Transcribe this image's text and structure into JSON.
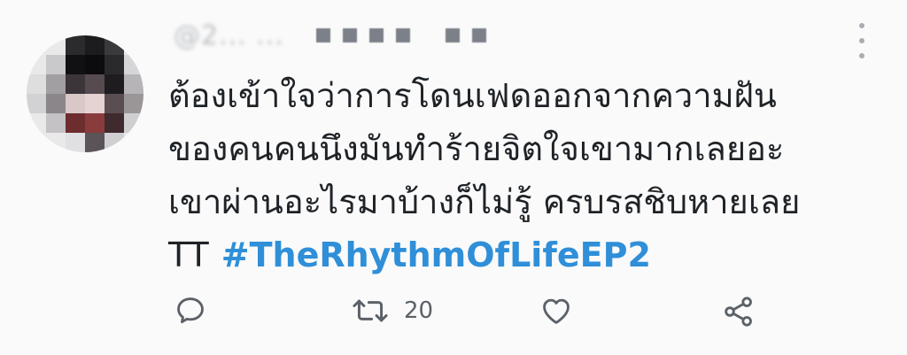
{
  "tweet": {
    "handle": "@2... ...",
    "text_lines": [
      "ต้องเข้าใจว่าการโดนเฟดออกจากความฝัน",
      "ของคนคนนึงมันทำร้ายจิตใจเขามากเลยอะ",
      "เขาผ่านอะไรมาบ้างก็ไม่รู้ ครบรสชิบหายเลย",
      "TT"
    ],
    "hashtag": "#TheRhythmOfLifeEP2"
  },
  "actions": {
    "reply_icon": "reply-icon",
    "retweet_icon": "retweet-icon",
    "retweet_count": "20",
    "like_icon": "heart-icon",
    "share_icon": "share-icon"
  },
  "colors": {
    "hashtag": "#2f8fd8",
    "text": "#1f2327",
    "icon": "#5b6167"
  }
}
